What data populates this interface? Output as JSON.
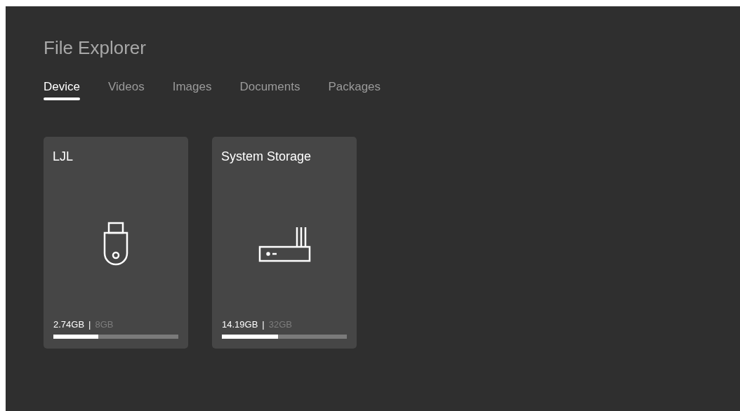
{
  "title": "File Explorer",
  "tabs": [
    {
      "label": "Device",
      "selected": true
    },
    {
      "label": "Videos",
      "selected": false
    },
    {
      "label": "Images",
      "selected": false
    },
    {
      "label": "Documents",
      "selected": false
    },
    {
      "label": "Packages",
      "selected": false
    }
  ],
  "devices": [
    {
      "name": "LJL",
      "kind": "usb",
      "used": "2.74GB",
      "separator": "|",
      "total": "8GB",
      "level": 0.36
    },
    {
      "name": "System Storage",
      "kind": "router",
      "used": "14.19GB",
      "separator": "|",
      "total": "32GB",
      "level": 0.45
    }
  ]
}
